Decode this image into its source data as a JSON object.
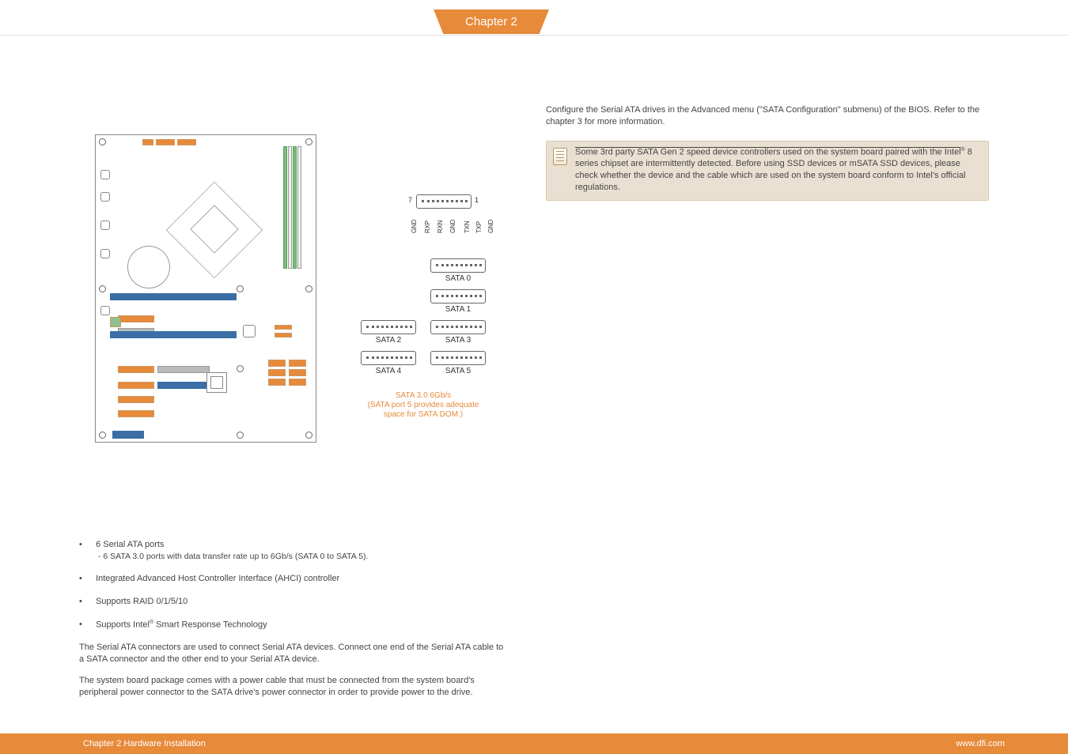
{
  "chapter_tab": "Chapter 2",
  "pin_header": {
    "left_num": "7",
    "right_num": "1",
    "pins": [
      "GND",
      "RXP",
      "RXN",
      "GND",
      "TXN",
      "TXP",
      "GND"
    ]
  },
  "sata_ports": {
    "p0": "SATA 0",
    "p1": "SATA 1",
    "p2": "SATA 2",
    "p3": "SATA 3",
    "p4": "SATA 4",
    "p5": "SATA 5",
    "note_l1": "SATA 3.0 6Gb/s",
    "note_l2": "(SATA port 5 provides adequate",
    "note_l3": "space for SATA DOM.)"
  },
  "features": {
    "f1": "6 Serial ATA ports",
    "f1_sub": "- 6 SATA 3.0 ports with data transfer rate up to 6Gb/s (SATA 0 to SATA 5).",
    "f2": "Integrated Advanced Host Controller Interface (AHCI) controller",
    "f3": "Supports RAID 0/1/5/10",
    "f4_a": "Supports Intel",
    "f4_b": " Smart Response Technology"
  },
  "body": {
    "p1": "The Serial ATA connectors are used to connect Serial ATA devices. Connect one end of the Serial ATA cable to a SATA connector and the other end to your Serial ATA device.",
    "p2": "The system board package comes with a power cable that must be connected from the system board's peripheral power connector to the SATA drive's power connector in order to provide power to the drive."
  },
  "right": {
    "intro": "Configure the Serial ATA drives in the Advanced menu (\"SATA Configuration\" submenu) of the BIOS. Refer to the chapter 3 for more information.",
    "note_a": "Some 3rd party SATA Gen 2 speed device controllers used on the system board paired with the Intel",
    "note_b": " 8 series chipset are intermittently detected. Before using SSD devices or mSATA SSD devices, please check whether the device and the cable which are used on the system board conform to Intel's official regulations."
  },
  "footer": {
    "left": "Chapter 2 Hardware Installation",
    "right": "www.dfi.com"
  },
  "reg": "®"
}
